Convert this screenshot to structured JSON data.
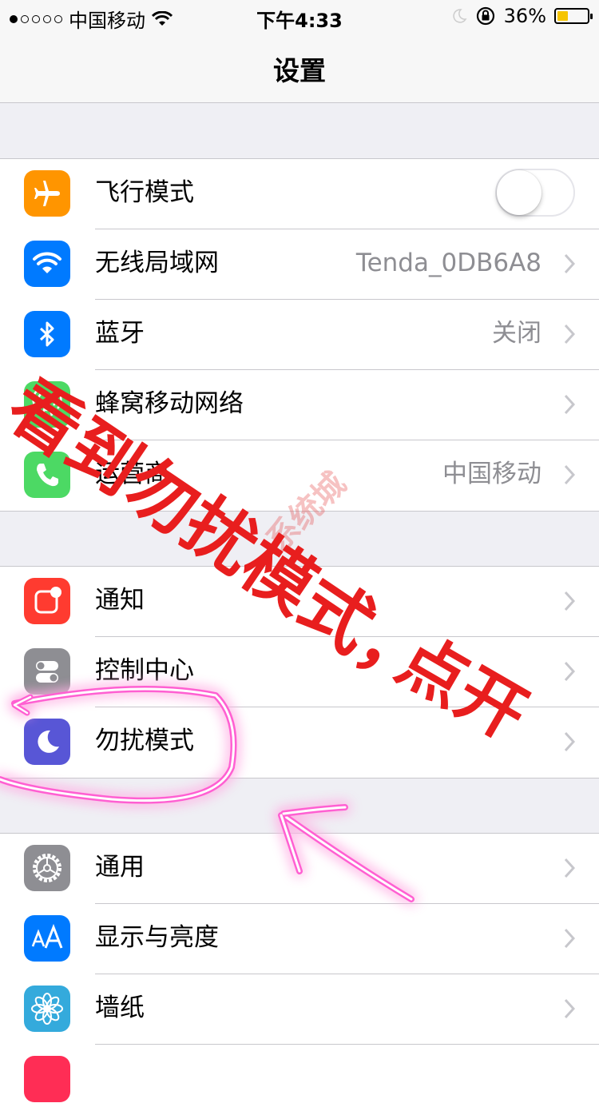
{
  "status_bar": {
    "carrier": "中国移动",
    "time": "下午4:33",
    "battery": "36%",
    "battery_level": 0.36
  },
  "nav": {
    "title": "设置"
  },
  "groups": [
    [
      {
        "label": "飞行模式",
        "icon": "airplane-icon",
        "color": "#ff9500",
        "toggle": false
      },
      {
        "label": "无线局域网",
        "icon": "wifi-icon",
        "color": "#007aff",
        "value": "Tenda_0DB6A8"
      },
      {
        "label": "蓝牙",
        "icon": "bluetooth-icon",
        "color": "#007aff",
        "value": "关闭"
      },
      {
        "label": "蜂窝移动网络",
        "icon": "cellular-icon",
        "color": "#4cd964",
        "value": ""
      },
      {
        "label": "运营商",
        "icon": "phone-icon",
        "color": "#4cd964",
        "value": "中国移动"
      }
    ],
    [
      {
        "label": "通知",
        "icon": "notifications-icon",
        "color": "#ff3b30",
        "value": ""
      },
      {
        "label": "控制中心",
        "icon": "control-center-icon",
        "color": "#8e8e93",
        "value": ""
      },
      {
        "label": "勿扰模式",
        "icon": "moon-icon",
        "color": "#5856d6",
        "value": ""
      }
    ],
    [
      {
        "label": "通用",
        "icon": "gear-icon",
        "color": "#8e8e93",
        "value": ""
      },
      {
        "label": "显示与亮度",
        "icon": "text-size-icon",
        "color": "#007aff",
        "value": ""
      },
      {
        "label": "墙纸",
        "icon": "flower-icon",
        "color": "#34aadc",
        "value": ""
      }
    ]
  ],
  "annotation": {
    "main": "看到勿扰模式，",
    "sub": "点开",
    "watermark": "系统城"
  }
}
